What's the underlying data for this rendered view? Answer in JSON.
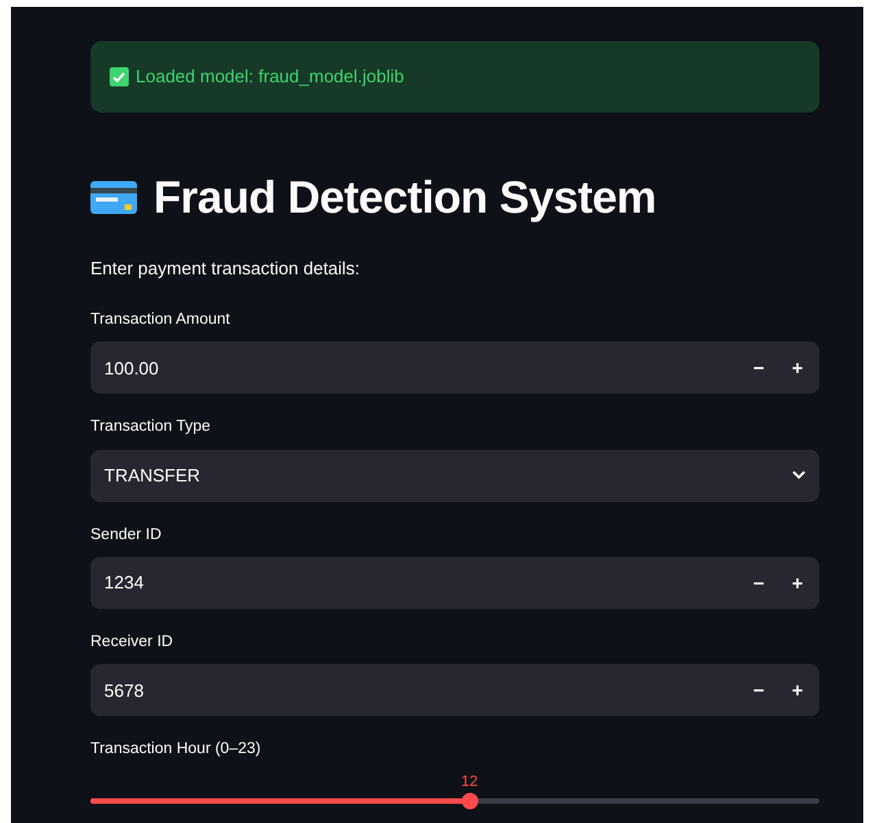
{
  "alert": {
    "text": "Loaded model: fraud_model.joblib"
  },
  "title": "Fraud Detection System",
  "subtitle": "Enter payment transaction details:",
  "fields": [
    {
      "kind": "number",
      "label": "Transaction Amount",
      "value": "100.00",
      "minus": "−",
      "plus": "+"
    },
    {
      "kind": "select",
      "label": "Transaction Type",
      "value": "TRANSFER"
    },
    {
      "kind": "number",
      "label": "Sender ID",
      "value": "1234",
      "minus": "−",
      "plus": "+"
    },
    {
      "kind": "number",
      "label": "Receiver ID",
      "value": "5678",
      "minus": "−",
      "plus": "+"
    },
    {
      "kind": "slider",
      "label": "Transaction Hour (0–23)",
      "reading": "12",
      "level": 0.52
    }
  ]
}
